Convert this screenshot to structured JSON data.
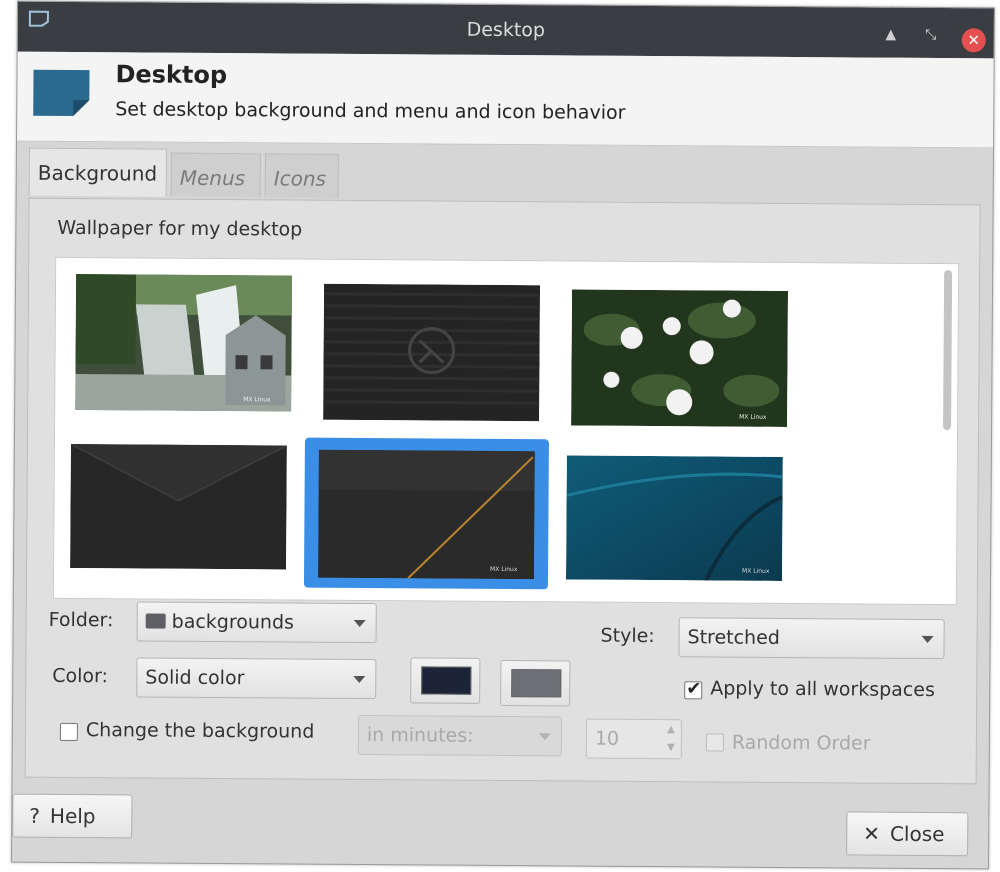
{
  "window": {
    "title": "Desktop"
  },
  "header": {
    "title": "Desktop",
    "subtitle": "Set desktop background and menu and icon behavior"
  },
  "tabs": [
    {
      "label": "Background",
      "active": true
    },
    {
      "label": "Menus",
      "active": false
    },
    {
      "label": "Icons",
      "active": false
    }
  ],
  "background": {
    "section_label": "Wallpaper for my desktop",
    "folder": {
      "label": "Folder:",
      "value": "backgrounds"
    },
    "style": {
      "label": "Style:",
      "value": "Stretched"
    },
    "color": {
      "label": "Color:",
      "value": "Solid color",
      "primary": "#1b2537",
      "secondary": "#6c6f76"
    },
    "apply_all": {
      "label": "Apply to all workspaces",
      "checked": true
    },
    "change_bg": {
      "label": "Change the background",
      "checked": false
    },
    "interval": {
      "value": "in minutes:"
    },
    "minutes": {
      "value": "10"
    },
    "random_order": {
      "label": "Random Order",
      "checked": false
    },
    "wallpapers": [
      {
        "name": "waterfall",
        "badge": "MX Linux"
      },
      {
        "name": "dark-stripes",
        "badge": ""
      },
      {
        "name": "white-flowers",
        "badge": "MX Linux"
      },
      {
        "name": "dark-envelope",
        "badge": ""
      },
      {
        "name": "dark-gold-line",
        "badge": "MX Linux",
        "selected": true
      },
      {
        "name": "teal-wave",
        "badge": "MX Linux"
      }
    ]
  },
  "footer": {
    "help_label": "Help",
    "close_label": "Close"
  }
}
